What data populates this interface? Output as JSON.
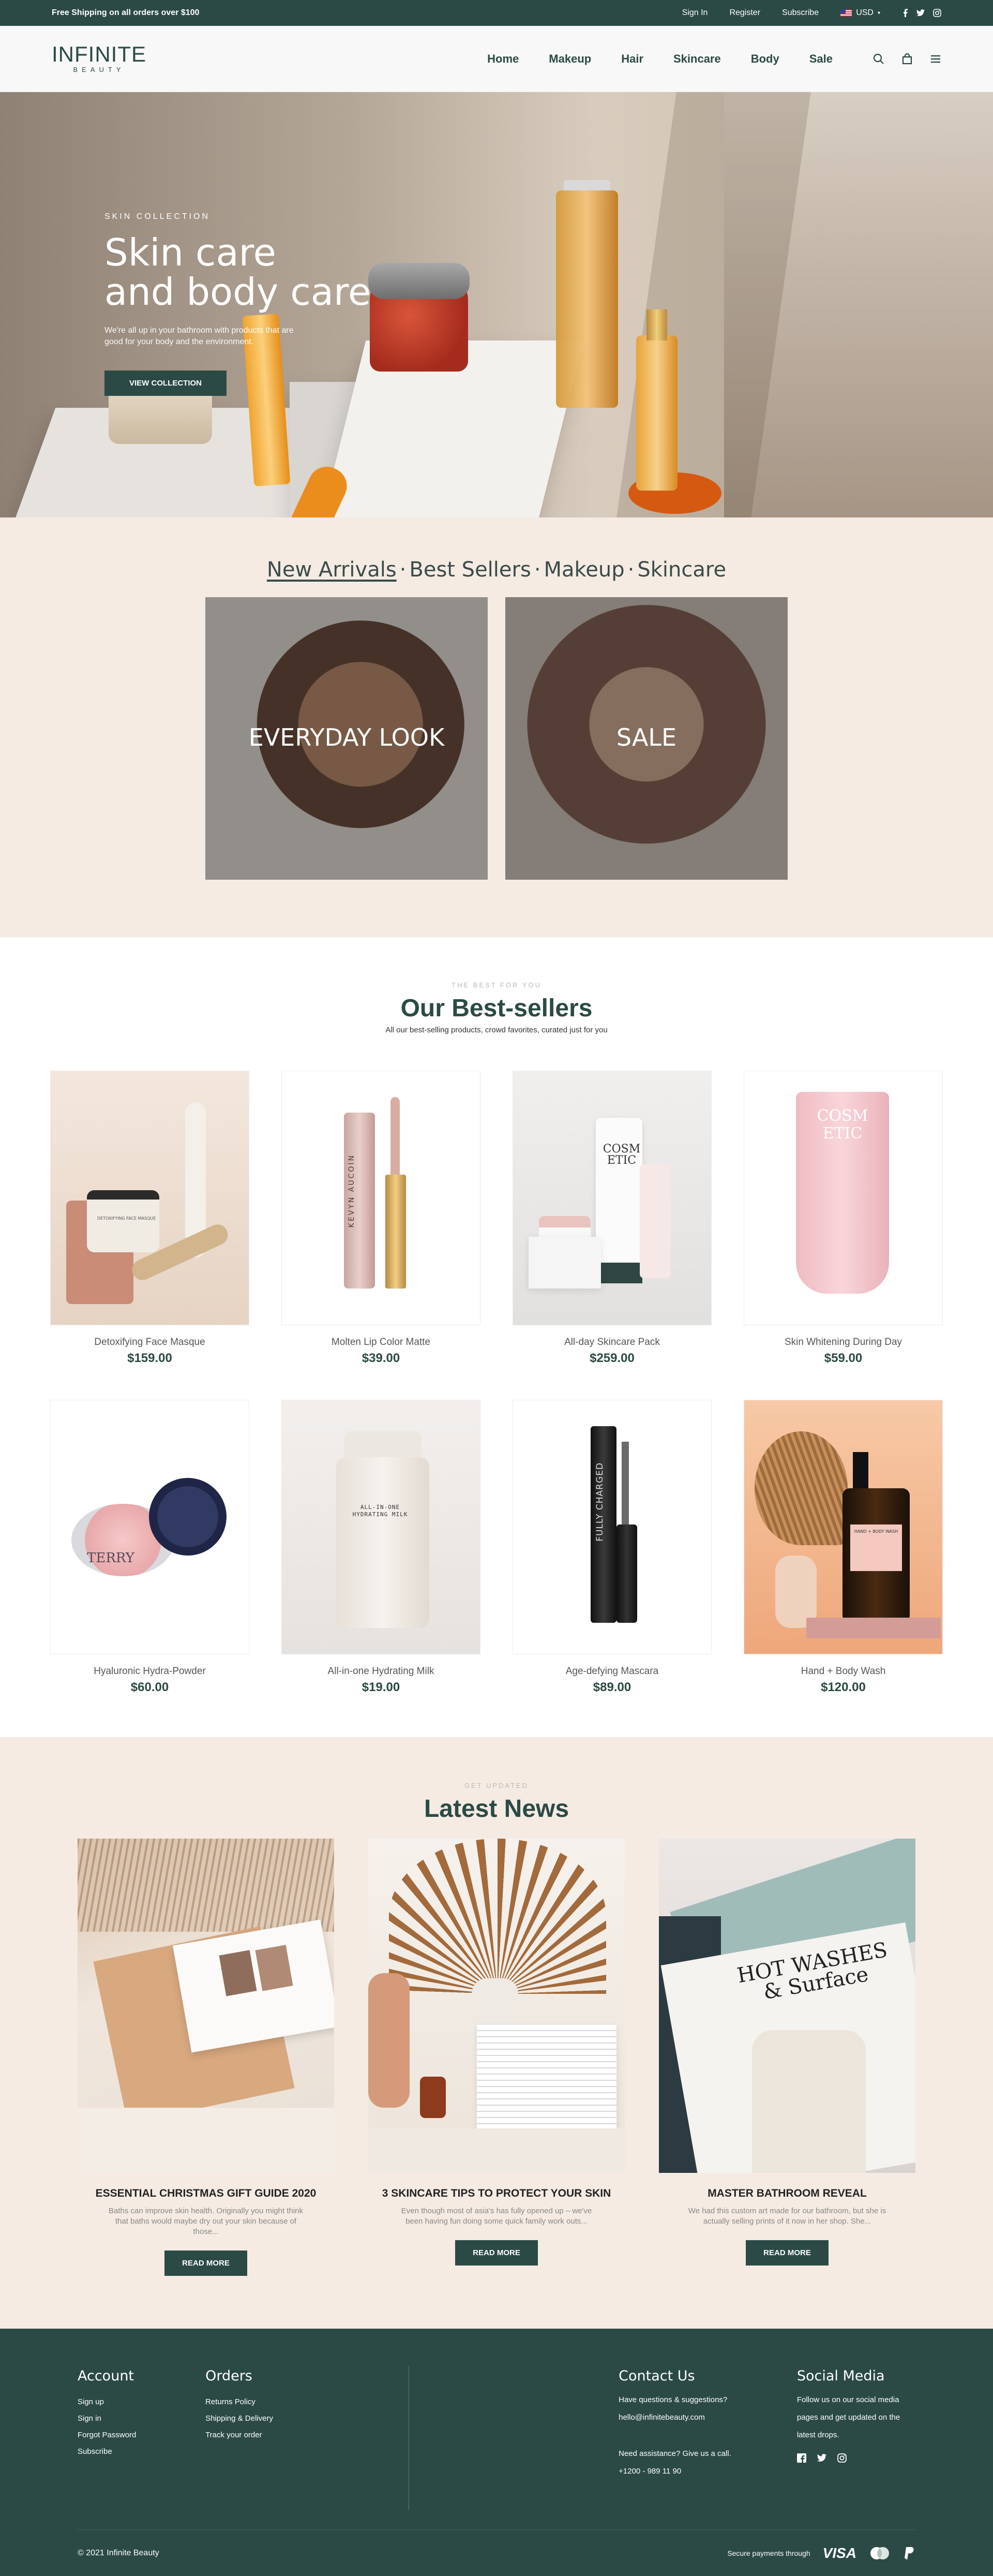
{
  "topbar": {
    "promo": "Free Shipping on all orders over $100",
    "links": [
      "Sign In",
      "Register",
      "Subscribe"
    ],
    "currency": "USD"
  },
  "header": {
    "logo_main": "INFINITE",
    "logo_sub": "BEAUTY",
    "nav": [
      "Home",
      "Makeup",
      "Hair",
      "Skincare",
      "Body",
      "Sale"
    ]
  },
  "hero": {
    "kicker": "SKIN COLLECTION",
    "title_line1": "Skin care",
    "title_line2": "and body care",
    "text": "We're all up in your bathroom with products that are good for your body and the environment.",
    "button": "VIEW COLLECTION"
  },
  "categories": {
    "tabs": [
      "New Arrivals",
      "Best Sellers",
      "Makeup",
      "Skincare"
    ],
    "active_tab": "New Arrivals",
    "cards": [
      "EVERYDAY LOOK",
      "SALE"
    ]
  },
  "bestsellers": {
    "eyebrow": "THE BEST FOR YOU",
    "title": "Our Best-sellers",
    "subtitle": "All our best-selling products, crowd favorites, curated just for you",
    "products": [
      {
        "name": "Detoxifying Face Masque",
        "price": "$159.00",
        "label": "DETOXIFYING FACE MASQUE"
      },
      {
        "name": "Molten Lip Color Matte",
        "price": "$39.00",
        "label": "KEVYN AUCOIN"
      },
      {
        "name": "All-day Skincare Pack",
        "price": "$259.00",
        "label": "COSM ETIC"
      },
      {
        "name": "Skin Whitening During Day",
        "price": "$59.00",
        "label": "COSM ETIC"
      },
      {
        "name": "Hyaluronic Hydra-Powder",
        "price": "$60.00",
        "label": "TERRY"
      },
      {
        "name": "All-in-one Hydrating Milk",
        "price": "$19.00",
        "label": "ALL-IN-ONE HYDRATING MILK"
      },
      {
        "name": "Age-defying Mascara",
        "price": "$89.00",
        "label": "FULLY CHARGED"
      },
      {
        "name": "Hand + Body Wash",
        "price": "$120.00",
        "label": "HAND + BODY WASH"
      }
    ]
  },
  "news": {
    "eyebrow": "GET UPDATED",
    "title": "Latest News",
    "button": "READ MORE",
    "posts": [
      {
        "title": "ESSENTIAL CHRISTMAS GIFT GUIDE 2020",
        "excerpt": "Baths can improve skin health. Originally you might think that baths would maybe dry out your skin because of those..."
      },
      {
        "title": "3 SKINCARE TIPS TO PROTECT YOUR SKIN",
        "excerpt": "Even though most of asia's has fully opened up – we've been having fun doing some quick family work outs..."
      },
      {
        "title": "MASTER BATHROOM REVEAL",
        "excerpt": "We had this custom art made for our bathroom, but she is actually selling prints of it now in her shop. She..."
      }
    ],
    "magazine_text": "HOT WASHES & Surface"
  },
  "footer": {
    "account": {
      "title": "Account",
      "links": [
        "Sign up",
        "Sign in",
        "Forgot Password",
        "Subscribe"
      ]
    },
    "orders": {
      "title": "Orders",
      "links": [
        "Returns Policy",
        "Shipping & Delivery",
        "Track your order"
      ]
    },
    "contact": {
      "title": "Contact Us",
      "line1": "Have questions & suggestions?",
      "email": "hello@infinitebeauty.com",
      "line2": "Need assistance? Give us a call.",
      "phone": "+1200 - 989 11 90"
    },
    "social": {
      "title": "Social Media",
      "text": "Follow us on our social media pages and get updated on the latest drops."
    },
    "copyright": "© 2021 Infinite Beauty",
    "payments_label": "Secure payments through",
    "visa": "VISA"
  },
  "colors": {
    "primary": "#2b4a45",
    "cream": "#f5ebe3"
  }
}
